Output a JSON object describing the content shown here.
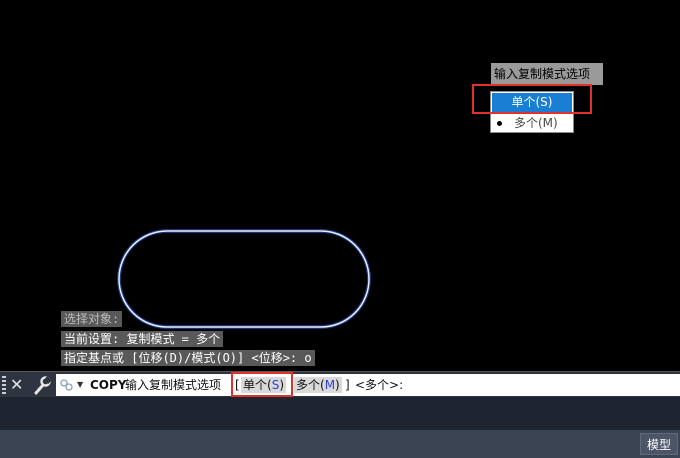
{
  "popup": {
    "title": "输入复制模式选项",
    "options": [
      {
        "label": "单个(S)",
        "selected": true
      },
      {
        "label": "多个(M)",
        "selected": false
      }
    ]
  },
  "history": [
    "选择对象:",
    "当前设置:  复制模式 = 多个",
    "指定基点或 [位移(D)/模式(O)] <位移>: o"
  ],
  "command_line": {
    "command": "COPY",
    "prompt": "输入复制模式选项",
    "open_bracket": "[",
    "options": [
      {
        "label": "单个(",
        "key": "S",
        "close": ")"
      },
      {
        "label": "多个(",
        "key": "M",
        "close": ")"
      }
    ],
    "close_bracket": "]",
    "default": "<多个>:"
  },
  "status": {
    "model_tab": "模型"
  },
  "colors": {
    "highlight_red": "#e0322a",
    "selected_blue": "#1a7fd4",
    "shape_outline": "#6f9cff"
  }
}
